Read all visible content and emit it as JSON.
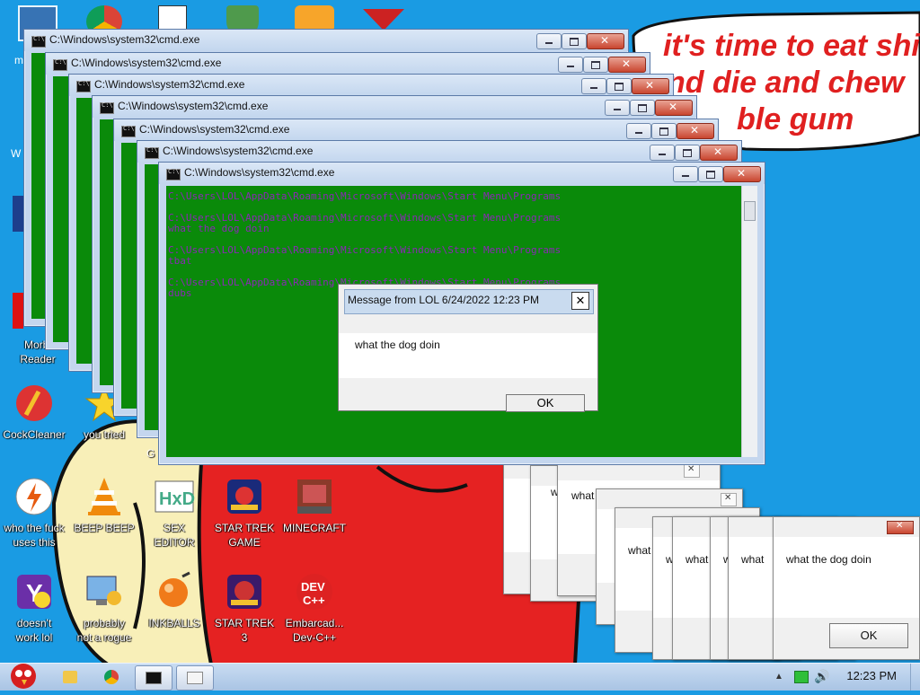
{
  "speech_bubble": {
    "line1": "it's time to eat shit",
    "line2": "nd die and chew",
    "line3": "ble gum"
  },
  "desktop_icons": [
    {
      "label": "Morbi\nReader"
    },
    {
      "label": "CockCleaner"
    },
    {
      "label": "you tried"
    },
    {
      "label": "G"
    },
    {
      "label": "who the fuck\nuses this"
    },
    {
      "label": "BEEP BEEP"
    },
    {
      "label": "SEX\nEDITOR"
    },
    {
      "label": "STAR TREK\nGAME"
    },
    {
      "label": "MINECRAFT"
    },
    {
      "label": "doesn't\nwork lol"
    },
    {
      "label": "probably\nnot a rogue"
    },
    {
      "label": "INKBALLS"
    },
    {
      "label": "STAR TREK\n3"
    },
    {
      "label": "Embarcad...\nDev-C++"
    }
  ],
  "cmd_windows": [
    {
      "title": "C:\\Windows\\system32\\cmd.exe"
    },
    {
      "title": "C:\\Windows\\system32\\cmd.exe"
    },
    {
      "title": "C:\\Windows\\system32\\cmd.exe"
    },
    {
      "title": "C:\\Windows\\system32\\cmd.exe"
    },
    {
      "title": "C:\\Windows\\system32\\cmd.exe"
    },
    {
      "title": "C:\\Windows\\system32\\cmd.exe"
    },
    {
      "title": "C:\\Windows\\system32\\cmd.exe"
    }
  ],
  "console_lines": [
    "C:\\Users\\LOL\\AppData\\Roaming\\Microsoft\\Windows\\Start Menu\\Programs",
    "",
    "C:\\Users\\LOL\\AppData\\Roaming\\Microsoft\\Windows\\Start Menu\\Programs",
    " what the dog doin",
    "",
    "C:\\Users\\LOL\\AppData\\Roaming\\Microsoft\\Windows\\Start Menu\\Programs",
    " tbat",
    "",
    "C:\\Users\\LOL\\AppData\\Roaming\\Microsoft\\Windows\\Start Menu\\Programs",
    " dubs"
  ],
  "message_dialog": {
    "title": "Message from LOL 6/24/2022 12:23 PM",
    "text": "what the dog doin",
    "ok": "OK"
  },
  "msgboxes": [
    {
      "text": "wha"
    },
    {
      "text": "what"
    },
    {
      "text": "what"
    },
    {
      "text": "what"
    },
    {
      "text": "what"
    },
    {
      "text": "what"
    },
    {
      "text": "what"
    },
    {
      "text": "what the dog doin",
      "ok": "OK"
    }
  ],
  "taskbar": {
    "clock": "12:23 PM"
  },
  "colors": {
    "desktop_bg": "#1a9be3",
    "console_bg": "#0a8a0a",
    "console_text": "#8a28b5",
    "bubble_text": "#e02020"
  }
}
